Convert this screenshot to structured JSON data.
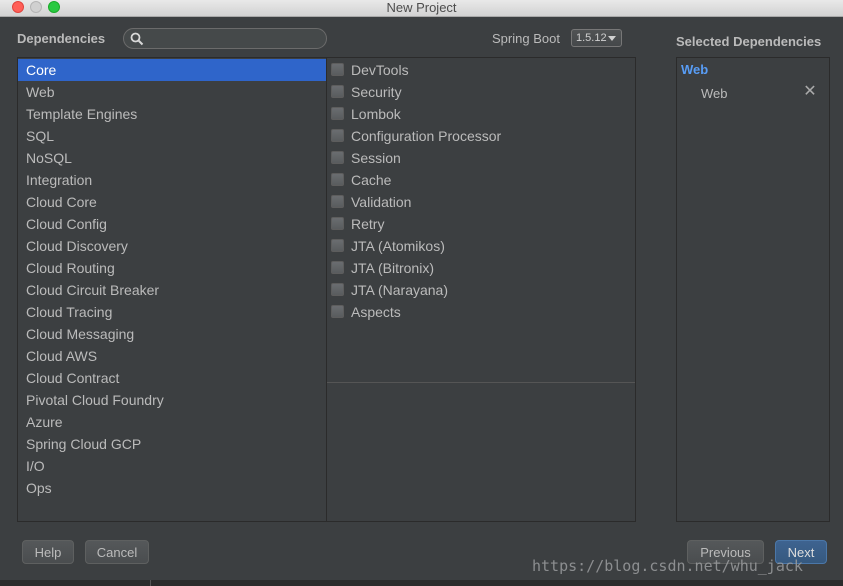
{
  "window": {
    "title": "New Project"
  },
  "header": {
    "dependencies_label": "Dependencies",
    "search": {
      "value": "",
      "placeholder": ""
    },
    "spring_boot_label": "Spring Boot",
    "spring_boot_version": "1.5.12",
    "selected_label": "Selected Dependencies"
  },
  "categories": [
    "Core",
    "Web",
    "Template Engines",
    "SQL",
    "NoSQL",
    "Integration",
    "Cloud Core",
    "Cloud Config",
    "Cloud Discovery",
    "Cloud Routing",
    "Cloud Circuit Breaker",
    "Cloud Tracing",
    "Cloud Messaging",
    "Cloud AWS",
    "Cloud Contract",
    "Pivotal Cloud Foundry",
    "Azure",
    "Spring Cloud GCP",
    "I/O",
    "Ops"
  ],
  "selected_category": "Core",
  "dependencies": [
    {
      "label": "DevTools",
      "checked": false
    },
    {
      "label": "Security",
      "checked": false
    },
    {
      "label": "Lombok",
      "checked": false
    },
    {
      "label": "Configuration Processor",
      "checked": false
    },
    {
      "label": "Session",
      "checked": false
    },
    {
      "label": "Cache",
      "checked": false
    },
    {
      "label": "Validation",
      "checked": false
    },
    {
      "label": "Retry",
      "checked": false
    },
    {
      "label": "JTA (Atomikos)",
      "checked": false
    },
    {
      "label": "JTA (Bitronix)",
      "checked": false
    },
    {
      "label": "JTA (Narayana)",
      "checked": false
    },
    {
      "label": "Aspects",
      "checked": false
    }
  ],
  "selected": {
    "group": "Web",
    "items": [
      "Web"
    ],
    "remove_glyph": "✕"
  },
  "buttons": {
    "help": "Help",
    "cancel": "Cancel",
    "previous": "Previous",
    "next": "Next"
  },
  "watermark": "https://blog.csdn.net/whu_jack",
  "colors": {
    "selection": "#2f65ca",
    "selected_group": "#589df6",
    "background": "#3c3f41"
  }
}
